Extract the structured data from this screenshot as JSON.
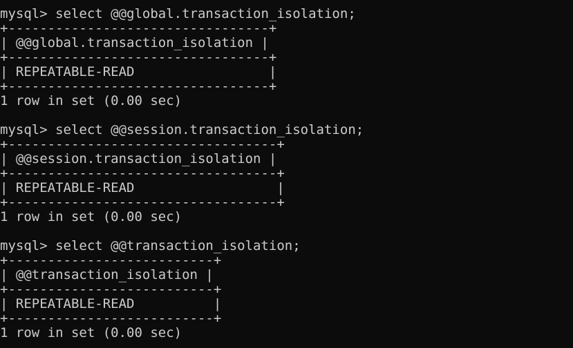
{
  "terminal": {
    "background": "#0c0c0c",
    "foreground": "#cccccc",
    "blocks": [
      {
        "prompt": "mysql> select @@global.transaction_isolation;",
        "border": "+---------------------------------+",
        "header": "| @@global.transaction_isolation |",
        "row": "| REPEATABLE-READ                 |",
        "footer": "1 row in set (0.00 sec)"
      },
      {
        "prompt": "mysql> select @@session.transaction_isolation;",
        "border": "+----------------------------------+",
        "header": "| @@session.transaction_isolation |",
        "row": "| REPEATABLE-READ                  |",
        "footer": "1 row in set (0.00 sec)"
      },
      {
        "prompt": "mysql> select @@transaction_isolation;",
        "border": "+--------------------------+",
        "header": "| @@transaction_isolation |",
        "row": "| REPEATABLE-READ          |",
        "footer": "1 row in set (0.00 sec)"
      }
    ]
  }
}
